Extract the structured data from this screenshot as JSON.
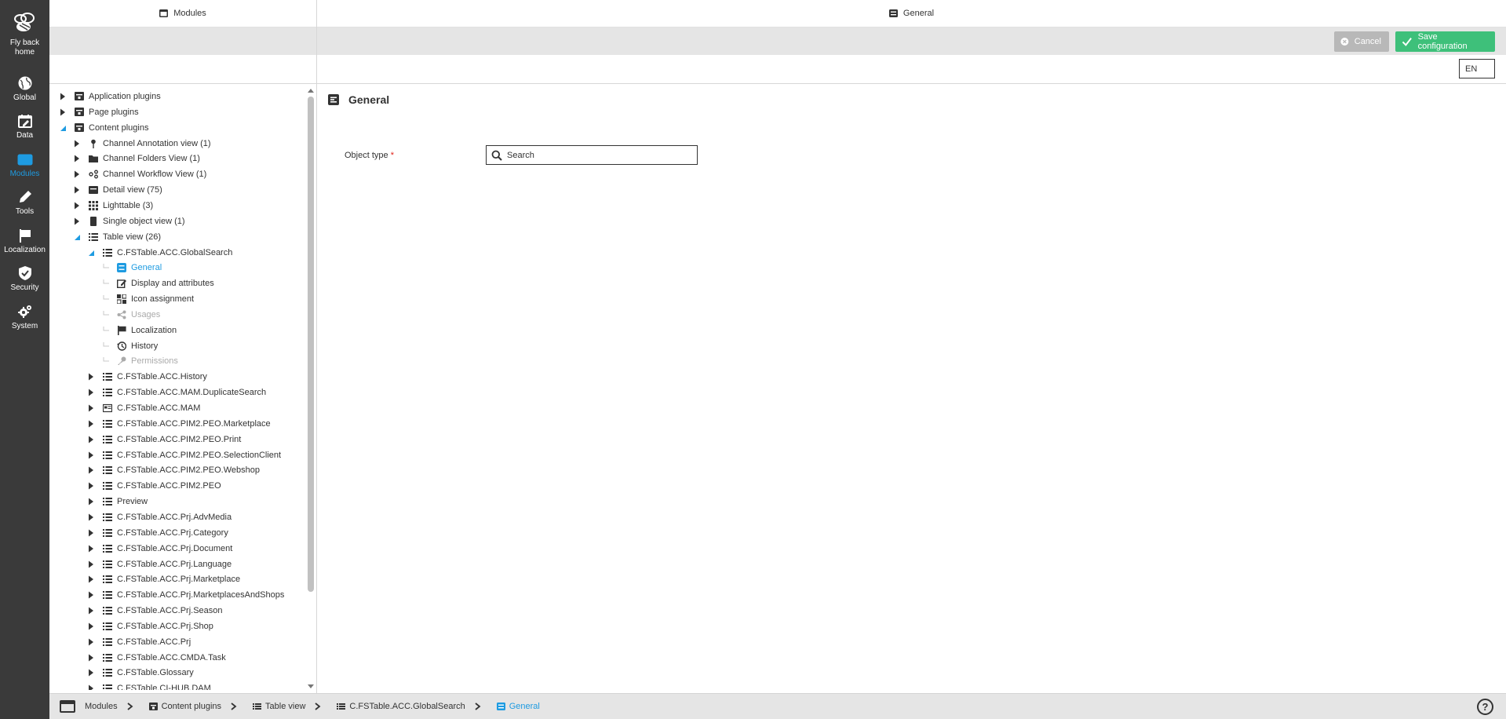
{
  "nav": {
    "items": [
      {
        "label": "Fly back home",
        "icon": "bee-logo-icon"
      },
      {
        "label": "Global",
        "icon": "globe-icon"
      },
      {
        "label": "Data",
        "icon": "calendar-edit-icon"
      },
      {
        "label": "Modules",
        "icon": "window-icon",
        "active": true
      },
      {
        "label": "Tools",
        "icon": "pencil-icon"
      },
      {
        "label": "Localization",
        "icon": "flag-icon"
      },
      {
        "label": "Security",
        "icon": "shield-check-icon"
      },
      {
        "label": "System",
        "icon": "cogs-icon"
      }
    ]
  },
  "left_panel": {
    "title": "Modules"
  },
  "right_panel": {
    "title": "General"
  },
  "toolbar": {
    "cancel_label": "Cancel",
    "save_label": "Save configuration",
    "language": "EN"
  },
  "tree": [
    {
      "label": "Application plugins",
      "level": 0,
      "state": "collapsed",
      "icon": "plugin-icon"
    },
    {
      "label": "Page plugins",
      "level": 0,
      "state": "collapsed",
      "icon": "plugin-icon"
    },
    {
      "label": "Content plugins",
      "level": 0,
      "state": "expanded",
      "icon": "plugin-icon"
    },
    {
      "label": "Channel Annotation view (1)",
      "level": 1,
      "state": "collapsed",
      "icon": "pin-icon"
    },
    {
      "label": "Channel Folders View (1)",
      "level": 1,
      "state": "collapsed",
      "icon": "folder-icon"
    },
    {
      "label": "Channel Workflow View (1)",
      "level": 1,
      "state": "collapsed",
      "icon": "workflow-icon"
    },
    {
      "label": "Detail view (75)",
      "level": 1,
      "state": "collapsed",
      "icon": "detail-icon"
    },
    {
      "label": "Lighttable (3)",
      "level": 1,
      "state": "collapsed",
      "icon": "grid-icon"
    },
    {
      "label": "Single object view (1)",
      "level": 1,
      "state": "collapsed",
      "icon": "single-object-icon"
    },
    {
      "label": "Table view (26)",
      "level": 1,
      "state": "expanded",
      "icon": "list-icon"
    },
    {
      "label": "C.FSTable.ACC.GlobalSearch",
      "level": 2,
      "state": "expanded",
      "icon": "list-icon"
    },
    {
      "label": "General",
      "level": 3,
      "state": "none",
      "icon": "general-icon",
      "selected": true
    },
    {
      "label": "Display and attributes",
      "level": 3,
      "state": "none",
      "icon": "edit-icon"
    },
    {
      "label": "Icon assignment",
      "level": 3,
      "state": "none",
      "icon": "icon-assign-icon"
    },
    {
      "label": "Usages",
      "level": 3,
      "state": "none",
      "icon": "usages-icon",
      "disabled": true
    },
    {
      "label": "Localization",
      "level": 3,
      "state": "none",
      "icon": "flag-icon"
    },
    {
      "label": "History",
      "level": 3,
      "state": "none",
      "icon": "history-icon"
    },
    {
      "label": "Permissions",
      "level": 3,
      "state": "none",
      "icon": "key-icon",
      "disabled": true
    },
    {
      "label": "C.FSTable.ACC.History",
      "level": 2,
      "state": "collapsed",
      "icon": "list-icon"
    },
    {
      "label": "C.FSTable.ACC.MAM.DuplicateSearch",
      "level": 2,
      "state": "collapsed",
      "icon": "list-icon"
    },
    {
      "label": "C.FSTable.ACC.MAM",
      "level": 2,
      "state": "collapsed",
      "icon": "image-card-icon"
    },
    {
      "label": "C.FSTable.ACC.PIM2.PEO.Marketplace",
      "level": 2,
      "state": "collapsed",
      "icon": "list-icon"
    },
    {
      "label": "C.FSTable.ACC.PIM2.PEO.Print",
      "level": 2,
      "state": "collapsed",
      "icon": "list-icon"
    },
    {
      "label": "C.FSTable.ACC.PIM2.PEO.SelectionClient",
      "level": 2,
      "state": "collapsed",
      "icon": "list-icon"
    },
    {
      "label": "C.FSTable.ACC.PIM2.PEO.Webshop",
      "level": 2,
      "state": "collapsed",
      "icon": "list-icon"
    },
    {
      "label": "C.FSTable.ACC.PIM2.PEO",
      "level": 2,
      "state": "collapsed",
      "icon": "list-icon"
    },
    {
      "label": "Preview",
      "level": 2,
      "state": "collapsed",
      "icon": "list-icon"
    },
    {
      "label": "C.FSTable.ACC.Prj.AdvMedia",
      "level": 2,
      "state": "collapsed",
      "icon": "list-icon"
    },
    {
      "label": "C.FSTable.ACC.Prj.Category",
      "level": 2,
      "state": "collapsed",
      "icon": "list-icon"
    },
    {
      "label": "C.FSTable.ACC.Prj.Document",
      "level": 2,
      "state": "collapsed",
      "icon": "list-icon"
    },
    {
      "label": "C.FSTable.ACC.Prj.Language",
      "level": 2,
      "state": "collapsed",
      "icon": "list-icon"
    },
    {
      "label": "C.FSTable.ACC.Prj.Marketplace",
      "level": 2,
      "state": "collapsed",
      "icon": "list-icon"
    },
    {
      "label": "C.FSTable.ACC.Prj.MarketplacesAndShops",
      "level": 2,
      "state": "collapsed",
      "icon": "list-icon"
    },
    {
      "label": "C.FSTable.ACC.Prj.Season",
      "level": 2,
      "state": "collapsed",
      "icon": "list-icon"
    },
    {
      "label": "C.FSTable.ACC.Prj.Shop",
      "level": 2,
      "state": "collapsed",
      "icon": "list-icon"
    },
    {
      "label": "C.FSTable.ACC.Prj",
      "level": 2,
      "state": "collapsed",
      "icon": "list-icon"
    },
    {
      "label": "C.FSTable.ACC.CMDA.Task",
      "level": 2,
      "state": "collapsed",
      "icon": "list-icon"
    },
    {
      "label": "C.FSTable.Glossary",
      "level": 2,
      "state": "collapsed",
      "icon": "list-icon"
    },
    {
      "label": "C.FSTable.CI-HUB.DAM",
      "level": 2,
      "state": "collapsed",
      "icon": "list-icon"
    }
  ],
  "content": {
    "title": "General",
    "field_label": "Object type",
    "required_mark": "*",
    "search_placeholder": "Search"
  },
  "breadcrumb": [
    {
      "label": "Modules",
      "icon": "window-icon"
    },
    {
      "label": "Content plugins",
      "icon": "plugin-icon"
    },
    {
      "label": "Table view",
      "icon": "list-icon"
    },
    {
      "label": "C.FSTable.ACC.GlobalSearch",
      "icon": "list-icon"
    },
    {
      "label": "General",
      "icon": "general-icon",
      "current": true
    }
  ],
  "help_label": "?",
  "colors": {
    "accent": "#1e9be1",
    "save": "#3ec07a",
    "cancel": "#b8b8b8",
    "nav_bg": "#3a3a3a",
    "required": "#e0241b"
  }
}
